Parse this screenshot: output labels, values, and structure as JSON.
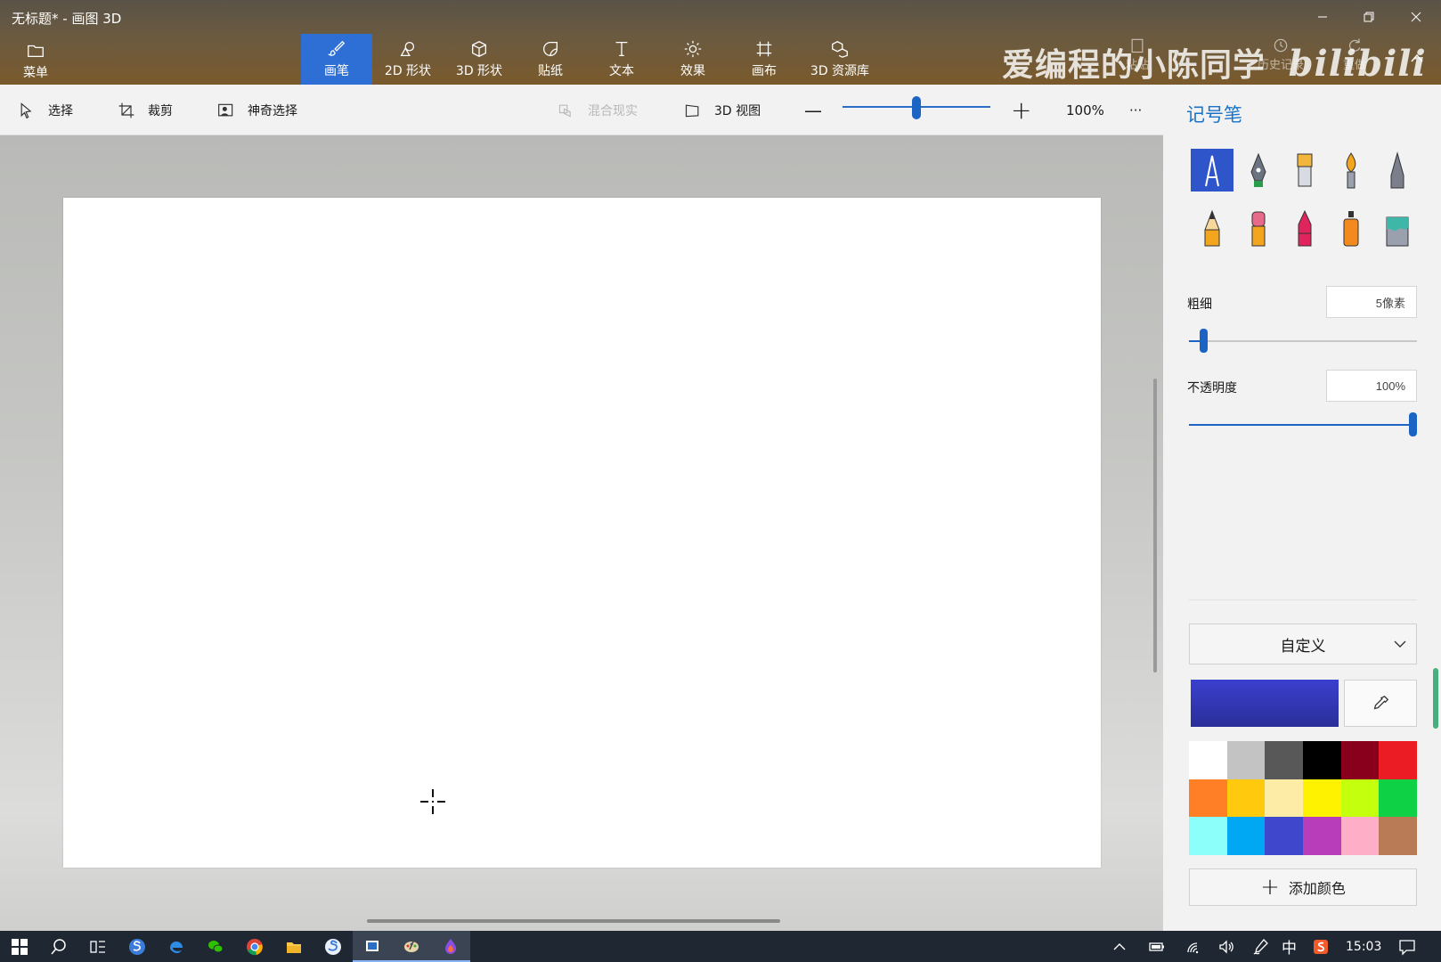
{
  "window": {
    "title": "无标题* - 画图 3D",
    "controls": [
      "minimize",
      "restore",
      "close"
    ]
  },
  "ribbon": {
    "menu_label": "菜单",
    "tools": [
      {
        "label": "画笔",
        "icon": "brush-icon",
        "active": true
      },
      {
        "label": "2D 形状",
        "icon": "2d-shapes-icon",
        "active": false
      },
      {
        "label": "3D 形状",
        "icon": "3d-shapes-icon",
        "active": false
      },
      {
        "label": "贴纸",
        "icon": "stickers-icon",
        "active": false
      },
      {
        "label": "文本",
        "icon": "text-icon",
        "active": false
      },
      {
        "label": "效果",
        "icon": "effects-icon",
        "active": false
      },
      {
        "label": "画布",
        "icon": "canvas-icon",
        "active": false
      },
      {
        "label": "3D 资源库",
        "icon": "3d-library-icon",
        "active": false
      }
    ],
    "right_tools": [
      {
        "label": "粘贴",
        "icon": "paste-icon"
      },
      {
        "label": "历史记录",
        "icon": "history-icon"
      },
      {
        "label": "重做",
        "icon": "redo-icon"
      }
    ],
    "watermark": "爱编程的小陈同学",
    "watermark_logo": "bilibili"
  },
  "toolbar": {
    "select_label": "选择",
    "crop_label": "裁剪",
    "magic_select_label": "神奇选择",
    "mixed_reality_label": "混合现实",
    "view_3d_label": "3D 视图",
    "zoom_out": "—",
    "zoom_in": "+",
    "zoom_level": "100%",
    "zoom_fraction": 0.5,
    "more": "···"
  },
  "panel": {
    "title": "记号笔",
    "brushes": [
      {
        "name": "marker",
        "color": "#ffffff",
        "selected": true
      },
      {
        "name": "calligraphy-pen",
        "color": "#2a9d4a",
        "selected": false
      },
      {
        "name": "oil-brush",
        "color": "#f3b63d",
        "selected": false
      },
      {
        "name": "watercolor",
        "color": "#f3a51d",
        "selected": false
      },
      {
        "name": "pixel-pen",
        "color": "#7b7f8c",
        "selected": false
      },
      {
        "name": "pencil",
        "color": "#f3a51d",
        "selected": false
      },
      {
        "name": "eraser",
        "color": "#e86a8a",
        "selected": false
      },
      {
        "name": "crayon",
        "color": "#e0245e",
        "selected": false
      },
      {
        "name": "spray-can",
        "color": "#f38a1d",
        "selected": false
      },
      {
        "name": "fill",
        "color": "#3fb7a8",
        "selected": false
      }
    ],
    "thickness_label": "粗细",
    "thickness_value": "5像素",
    "thickness_fraction": 0.05,
    "opacity_label": "不透明度",
    "opacity_value": "100%",
    "opacity_fraction": 1.0,
    "dropdown_label": "自定义",
    "current_color": "#3b3fcf",
    "palette": [
      "#ffffff",
      "#c3c3c3",
      "#585858",
      "#000000",
      "#88001b",
      "#ec1c24",
      "#ff7f27",
      "#ffc90e",
      "#fdeca6",
      "#fff200",
      "#c4ff0e",
      "#0ed145",
      "#8cfffb",
      "#00a8f3",
      "#3f48cc",
      "#b83dba",
      "#ffaec8",
      "#b97a56"
    ],
    "add_color_label": "添加颜色"
  },
  "taskbar": {
    "apps": [
      "start-icon",
      "search-icon",
      "task-view-icon",
      "sogou-icon",
      "edge-icon",
      "wechat-icon",
      "chrome-icon",
      "file-explorer-icon",
      "browser-icon",
      "app-icon",
      "paint-icon",
      "paint3d-icon"
    ],
    "tray_ime": "中",
    "time": "15:03"
  }
}
